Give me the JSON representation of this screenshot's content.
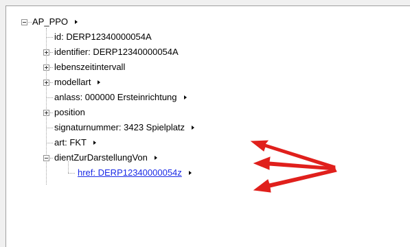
{
  "tree": {
    "root_label": "AP_PPO",
    "items": [
      {
        "label": "id: DERP12340000054A"
      },
      {
        "label": "identifier: DERP12340000054A"
      },
      {
        "label": "lebenszeitintervall"
      },
      {
        "label": "modellart"
      },
      {
        "label": "anlass: 000000 Ersteinrichtung"
      },
      {
        "label": "position"
      },
      {
        "label": "signaturnummer: 3423 Spielplatz"
      },
      {
        "label": "art: FKT"
      },
      {
        "label": "dientZurDarstellungVon"
      },
      {
        "label": "href: DERP12340000054z"
      }
    ]
  },
  "colors": {
    "link": "#1a2ae6",
    "annotation_arrow": "#e0201c"
  }
}
